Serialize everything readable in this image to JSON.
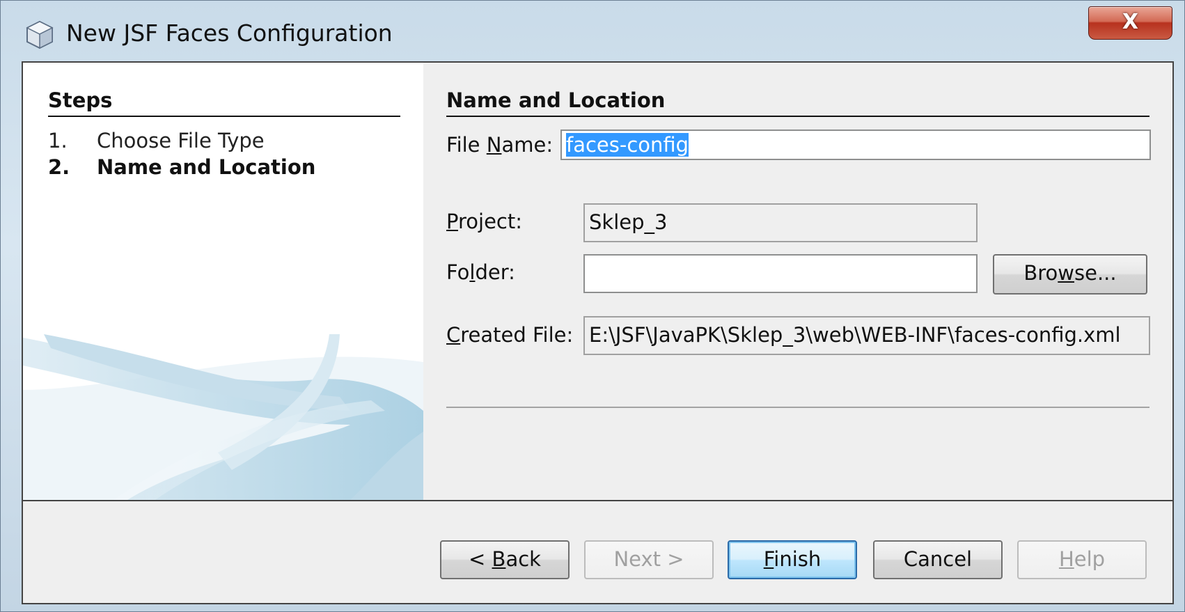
{
  "window": {
    "title": "New JSF Faces Configuration",
    "icon": "netbeans-cube-icon",
    "close_label": "X"
  },
  "steps": {
    "heading": "Steps",
    "items": [
      {
        "number": "1.",
        "label": "Choose File Type",
        "current": false
      },
      {
        "number": "2.",
        "label": "Name and Location",
        "current": true
      }
    ]
  },
  "main": {
    "heading": "Name and Location",
    "file_name": {
      "label_pre": "File ",
      "label_mnemonic": "N",
      "label_post": "ame:",
      "value": "faces-config"
    },
    "project": {
      "label_mnemonic": "P",
      "label_post": "roject:",
      "value": "Sklep_3"
    },
    "folder": {
      "label_pre": "Fo",
      "label_mnemonic": "l",
      "label_post": "der:",
      "value": ""
    },
    "browse": {
      "label_pre": "Bro",
      "label_mnemonic": "w",
      "label_post": "se..."
    },
    "created_file": {
      "label_mnemonic": "C",
      "label_post": "reated File:",
      "value": "E:\\JSF\\JavaPK\\Sklep_3\\web\\WEB-INF\\faces-config.xml"
    }
  },
  "buttons": {
    "back": {
      "label_pre": "< ",
      "label_mnemonic": "B",
      "label_post": "ack",
      "enabled": true
    },
    "next": {
      "label": "Next >",
      "enabled": false
    },
    "finish": {
      "label_mnemonic": "F",
      "label_post": "inish",
      "enabled": true
    },
    "cancel": {
      "label": "Cancel",
      "enabled": true
    },
    "help": {
      "label_mnemonic": "H",
      "label_post": "elp",
      "enabled": false
    }
  },
  "colors": {
    "selection": "#3399ff",
    "close_button": "#c9442c",
    "default_button_border": "#2a6aa8",
    "decor_swoosh": "#b9d6e6"
  }
}
